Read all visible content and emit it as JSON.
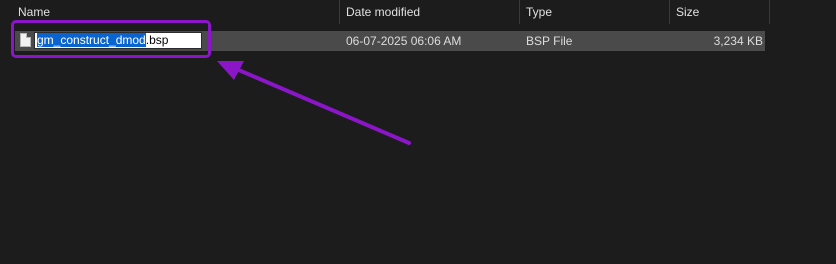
{
  "header": {
    "columns": [
      {
        "label": "Name"
      },
      {
        "label": "Date modified"
      },
      {
        "label": "Type"
      },
      {
        "label": "Size"
      }
    ],
    "sort_indicator": "^"
  },
  "file": {
    "name_selected": "gm_construct_dmod",
    "name_extension": ".bsp",
    "date_modified": "06-07-2025 06:06 AM",
    "type": "BSP File",
    "size": "3,234 KB",
    "icon": "document-icon"
  },
  "annotation": {
    "color": "#8a16c8",
    "shape": "rounded-rectangle-with-arrow"
  },
  "colors": {
    "background": "#1c1c1c",
    "row_selected": "#4a4a4a",
    "text_selection": "#0a64d0"
  }
}
